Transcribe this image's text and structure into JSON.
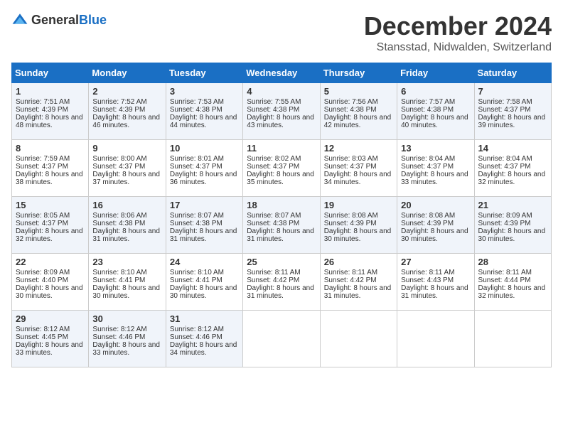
{
  "header": {
    "logo_general": "General",
    "logo_blue": "Blue",
    "title": "December 2024",
    "subtitle": "Stansstad, Nidwalden, Switzerland"
  },
  "days_of_week": [
    "Sunday",
    "Monday",
    "Tuesday",
    "Wednesday",
    "Thursday",
    "Friday",
    "Saturday"
  ],
  "weeks": [
    [
      {
        "day": "1",
        "sunrise": "Sunrise: 7:51 AM",
        "sunset": "Sunset: 4:39 PM",
        "daylight": "Daylight: 8 hours and 48 minutes."
      },
      {
        "day": "2",
        "sunrise": "Sunrise: 7:52 AM",
        "sunset": "Sunset: 4:39 PM",
        "daylight": "Daylight: 8 hours and 46 minutes."
      },
      {
        "day": "3",
        "sunrise": "Sunrise: 7:53 AM",
        "sunset": "Sunset: 4:38 PM",
        "daylight": "Daylight: 8 hours and 44 minutes."
      },
      {
        "day": "4",
        "sunrise": "Sunrise: 7:55 AM",
        "sunset": "Sunset: 4:38 PM",
        "daylight": "Daylight: 8 hours and 43 minutes."
      },
      {
        "day": "5",
        "sunrise": "Sunrise: 7:56 AM",
        "sunset": "Sunset: 4:38 PM",
        "daylight": "Daylight: 8 hours and 42 minutes."
      },
      {
        "day": "6",
        "sunrise": "Sunrise: 7:57 AM",
        "sunset": "Sunset: 4:38 PM",
        "daylight": "Daylight: 8 hours and 40 minutes."
      },
      {
        "day": "7",
        "sunrise": "Sunrise: 7:58 AM",
        "sunset": "Sunset: 4:37 PM",
        "daylight": "Daylight: 8 hours and 39 minutes."
      }
    ],
    [
      {
        "day": "8",
        "sunrise": "Sunrise: 7:59 AM",
        "sunset": "Sunset: 4:37 PM",
        "daylight": "Daylight: 8 hours and 38 minutes."
      },
      {
        "day": "9",
        "sunrise": "Sunrise: 8:00 AM",
        "sunset": "Sunset: 4:37 PM",
        "daylight": "Daylight: 8 hours and 37 minutes."
      },
      {
        "day": "10",
        "sunrise": "Sunrise: 8:01 AM",
        "sunset": "Sunset: 4:37 PM",
        "daylight": "Daylight: 8 hours and 36 minutes."
      },
      {
        "day": "11",
        "sunrise": "Sunrise: 8:02 AM",
        "sunset": "Sunset: 4:37 PM",
        "daylight": "Daylight: 8 hours and 35 minutes."
      },
      {
        "day": "12",
        "sunrise": "Sunrise: 8:03 AM",
        "sunset": "Sunset: 4:37 PM",
        "daylight": "Daylight: 8 hours and 34 minutes."
      },
      {
        "day": "13",
        "sunrise": "Sunrise: 8:04 AM",
        "sunset": "Sunset: 4:37 PM",
        "daylight": "Daylight: 8 hours and 33 minutes."
      },
      {
        "day": "14",
        "sunrise": "Sunrise: 8:04 AM",
        "sunset": "Sunset: 4:37 PM",
        "daylight": "Daylight: 8 hours and 32 minutes."
      }
    ],
    [
      {
        "day": "15",
        "sunrise": "Sunrise: 8:05 AM",
        "sunset": "Sunset: 4:37 PM",
        "daylight": "Daylight: 8 hours and 32 minutes."
      },
      {
        "day": "16",
        "sunrise": "Sunrise: 8:06 AM",
        "sunset": "Sunset: 4:38 PM",
        "daylight": "Daylight: 8 hours and 31 minutes."
      },
      {
        "day": "17",
        "sunrise": "Sunrise: 8:07 AM",
        "sunset": "Sunset: 4:38 PM",
        "daylight": "Daylight: 8 hours and 31 minutes."
      },
      {
        "day": "18",
        "sunrise": "Sunrise: 8:07 AM",
        "sunset": "Sunset: 4:38 PM",
        "daylight": "Daylight: 8 hours and 31 minutes."
      },
      {
        "day": "19",
        "sunrise": "Sunrise: 8:08 AM",
        "sunset": "Sunset: 4:39 PM",
        "daylight": "Daylight: 8 hours and 30 minutes."
      },
      {
        "day": "20",
        "sunrise": "Sunrise: 8:08 AM",
        "sunset": "Sunset: 4:39 PM",
        "daylight": "Daylight: 8 hours and 30 minutes."
      },
      {
        "day": "21",
        "sunrise": "Sunrise: 8:09 AM",
        "sunset": "Sunset: 4:39 PM",
        "daylight": "Daylight: 8 hours and 30 minutes."
      }
    ],
    [
      {
        "day": "22",
        "sunrise": "Sunrise: 8:09 AM",
        "sunset": "Sunset: 4:40 PM",
        "daylight": "Daylight: 8 hours and 30 minutes."
      },
      {
        "day": "23",
        "sunrise": "Sunrise: 8:10 AM",
        "sunset": "Sunset: 4:41 PM",
        "daylight": "Daylight: 8 hours and 30 minutes."
      },
      {
        "day": "24",
        "sunrise": "Sunrise: 8:10 AM",
        "sunset": "Sunset: 4:41 PM",
        "daylight": "Daylight: 8 hours and 30 minutes."
      },
      {
        "day": "25",
        "sunrise": "Sunrise: 8:11 AM",
        "sunset": "Sunset: 4:42 PM",
        "daylight": "Daylight: 8 hours and 31 minutes."
      },
      {
        "day": "26",
        "sunrise": "Sunrise: 8:11 AM",
        "sunset": "Sunset: 4:42 PM",
        "daylight": "Daylight: 8 hours and 31 minutes."
      },
      {
        "day": "27",
        "sunrise": "Sunrise: 8:11 AM",
        "sunset": "Sunset: 4:43 PM",
        "daylight": "Daylight: 8 hours and 31 minutes."
      },
      {
        "day": "28",
        "sunrise": "Sunrise: 8:11 AM",
        "sunset": "Sunset: 4:44 PM",
        "daylight": "Daylight: 8 hours and 32 minutes."
      }
    ],
    [
      {
        "day": "29",
        "sunrise": "Sunrise: 8:12 AM",
        "sunset": "Sunset: 4:45 PM",
        "daylight": "Daylight: 8 hours and 33 minutes."
      },
      {
        "day": "30",
        "sunrise": "Sunrise: 8:12 AM",
        "sunset": "Sunset: 4:46 PM",
        "daylight": "Daylight: 8 hours and 33 minutes."
      },
      {
        "day": "31",
        "sunrise": "Sunrise: 8:12 AM",
        "sunset": "Sunset: 4:46 PM",
        "daylight": "Daylight: 8 hours and 34 minutes."
      },
      null,
      null,
      null,
      null
    ]
  ]
}
